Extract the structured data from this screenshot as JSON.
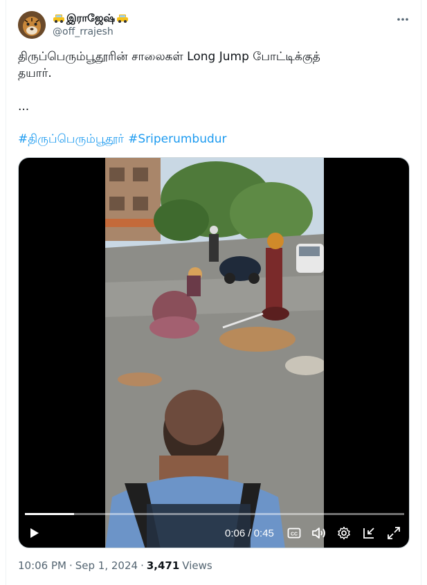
{
  "author": {
    "display_name": "இராஜேஷ்",
    "handle": "@off_rrajesh",
    "name_emoji_left": "taxi-icon",
    "name_emoji_right": "taxi-icon"
  },
  "tweet": {
    "text": "திருப்பெரும்பூதூரின் சாலைகள் Long Jump போட்டிக்குத்\nதயார்.",
    "ellipsis": "...",
    "hashtags": [
      "#திருப்பெரும்பூதூர்",
      "#Sriperumbudur"
    ]
  },
  "video": {
    "time": "0:06 / 0:45",
    "progress_fraction": 0.13
  },
  "footer": {
    "time": "10:06 PM",
    "sep1": "·",
    "date": "Sep 1, 2024",
    "sep2": "·",
    "views_count": "3,471",
    "views_label": "Views"
  },
  "colors": {
    "accent": "#1d9bf0",
    "secondary_text": "#536471"
  }
}
